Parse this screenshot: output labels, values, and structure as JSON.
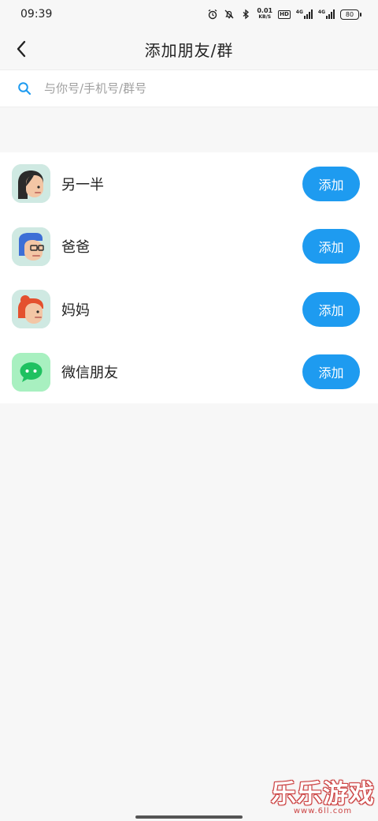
{
  "status_bar": {
    "time": "09:39",
    "net_speed_value": "0.01",
    "net_speed_unit": "KB/S",
    "hd_label": "HD",
    "signal_1": "4G",
    "signal_2": "4G",
    "battery": "80"
  },
  "header": {
    "title": "添加朋友/群"
  },
  "search": {
    "placeholder": "与你号/手机号/群号"
  },
  "list": {
    "items": [
      {
        "label": "另一半",
        "button": "添加",
        "avatar": "partner-avatar"
      },
      {
        "label": "爸爸",
        "button": "添加",
        "avatar": "father-avatar"
      },
      {
        "label": "妈妈",
        "button": "添加",
        "avatar": "mother-avatar"
      },
      {
        "label": "微信朋友",
        "button": "添加",
        "avatar": "wechat-icon"
      }
    ]
  },
  "watermark": {
    "main": "乐乐游戏",
    "sub": "www.6ll.com"
  },
  "colors": {
    "accent": "#1e9bf0",
    "background": "#f7f7f7",
    "avatar_bg": "#cfe9e2",
    "wechat_bg": "#a8f0c0",
    "wechat_green": "#1fc160"
  }
}
